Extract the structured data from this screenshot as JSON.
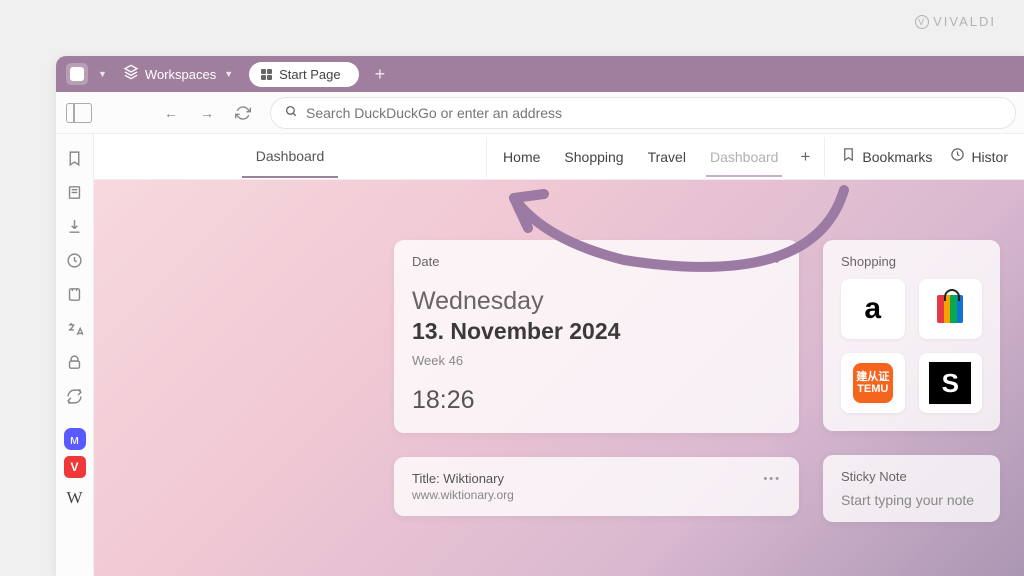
{
  "watermark": "VIVALDI",
  "titlebar": {
    "workspaces_label": "Workspaces",
    "tab_label": "Start Page"
  },
  "addressbar": {
    "placeholder": "Search DuckDuckGo or enter an address"
  },
  "nav_strip": {
    "active_underline": "Dashboard",
    "tabs": [
      "Home",
      "Shopping",
      "Travel",
      "Dashboard"
    ],
    "quick_bookmarks": "Bookmarks",
    "quick_history": "Histor"
  },
  "widgets": {
    "date": {
      "title": "Date",
      "day": "Wednesday",
      "full": "13. November 2024",
      "week": "Week 46",
      "time": "18:26"
    },
    "feed": {
      "title": "Title: Wiktionary",
      "url": "www.wiktionary.org"
    },
    "shopping": {
      "title": "Shopping",
      "tiles": {
        "amazon": "a",
        "temu_line1": "建从证",
        "temu_line2": "TEMU",
        "shein": "S"
      }
    },
    "sticky": {
      "title": "Sticky Note",
      "body": "Start typing your note"
    }
  }
}
